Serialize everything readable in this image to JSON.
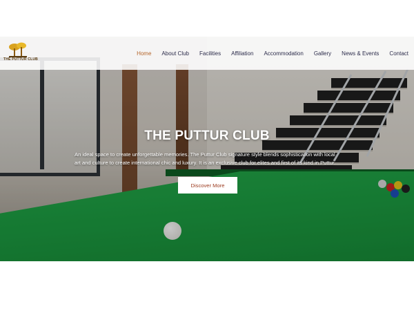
{
  "brand": {
    "logo_text": "THE PUTTUR CLUB"
  },
  "nav": {
    "items": [
      {
        "label": "Home",
        "active": true
      },
      {
        "label": "About Club",
        "active": false
      },
      {
        "label": "Facilities",
        "active": false
      },
      {
        "label": "Affiliation",
        "active": false
      },
      {
        "label": "Accommodation",
        "active": false
      },
      {
        "label": "Gallery",
        "active": false
      },
      {
        "label": "News & Events",
        "active": false
      },
      {
        "label": "Contact",
        "active": false
      }
    ]
  },
  "hero": {
    "title": "THE PUTTUR CLUB",
    "description": "An ideal space to create unforgettable memories. The Puttur Club signature style blends sophistication with local art and culture to create international chic and luxury. It is an exclusive club for elites and first of its kind in Puttur.",
    "cta_label": "Discover More"
  },
  "colors": {
    "accent": "#b5652a",
    "nav_text": "#2b2b4a",
    "cta_text": "#9b3a1e",
    "table_green": "#1c9c41"
  }
}
